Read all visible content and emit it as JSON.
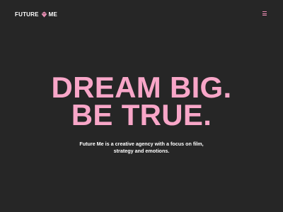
{
  "header": {
    "logo_left": "FUTURE",
    "logo_right": "ME",
    "logo_icon": "diamond-gem-icon",
    "menu_icon": "hamburger-menu-icon"
  },
  "hero": {
    "headline": [
      "DREAM BIG.",
      "BE TRUE."
    ],
    "tagline": [
      "Future Me is a creative agency with a focus on film,",
      "strategy and emotions."
    ]
  },
  "colors": {
    "background": "#262626",
    "accent": "#f8a6c8",
    "menu_accent": "#e88ab2",
    "text": "#ffffff"
  }
}
